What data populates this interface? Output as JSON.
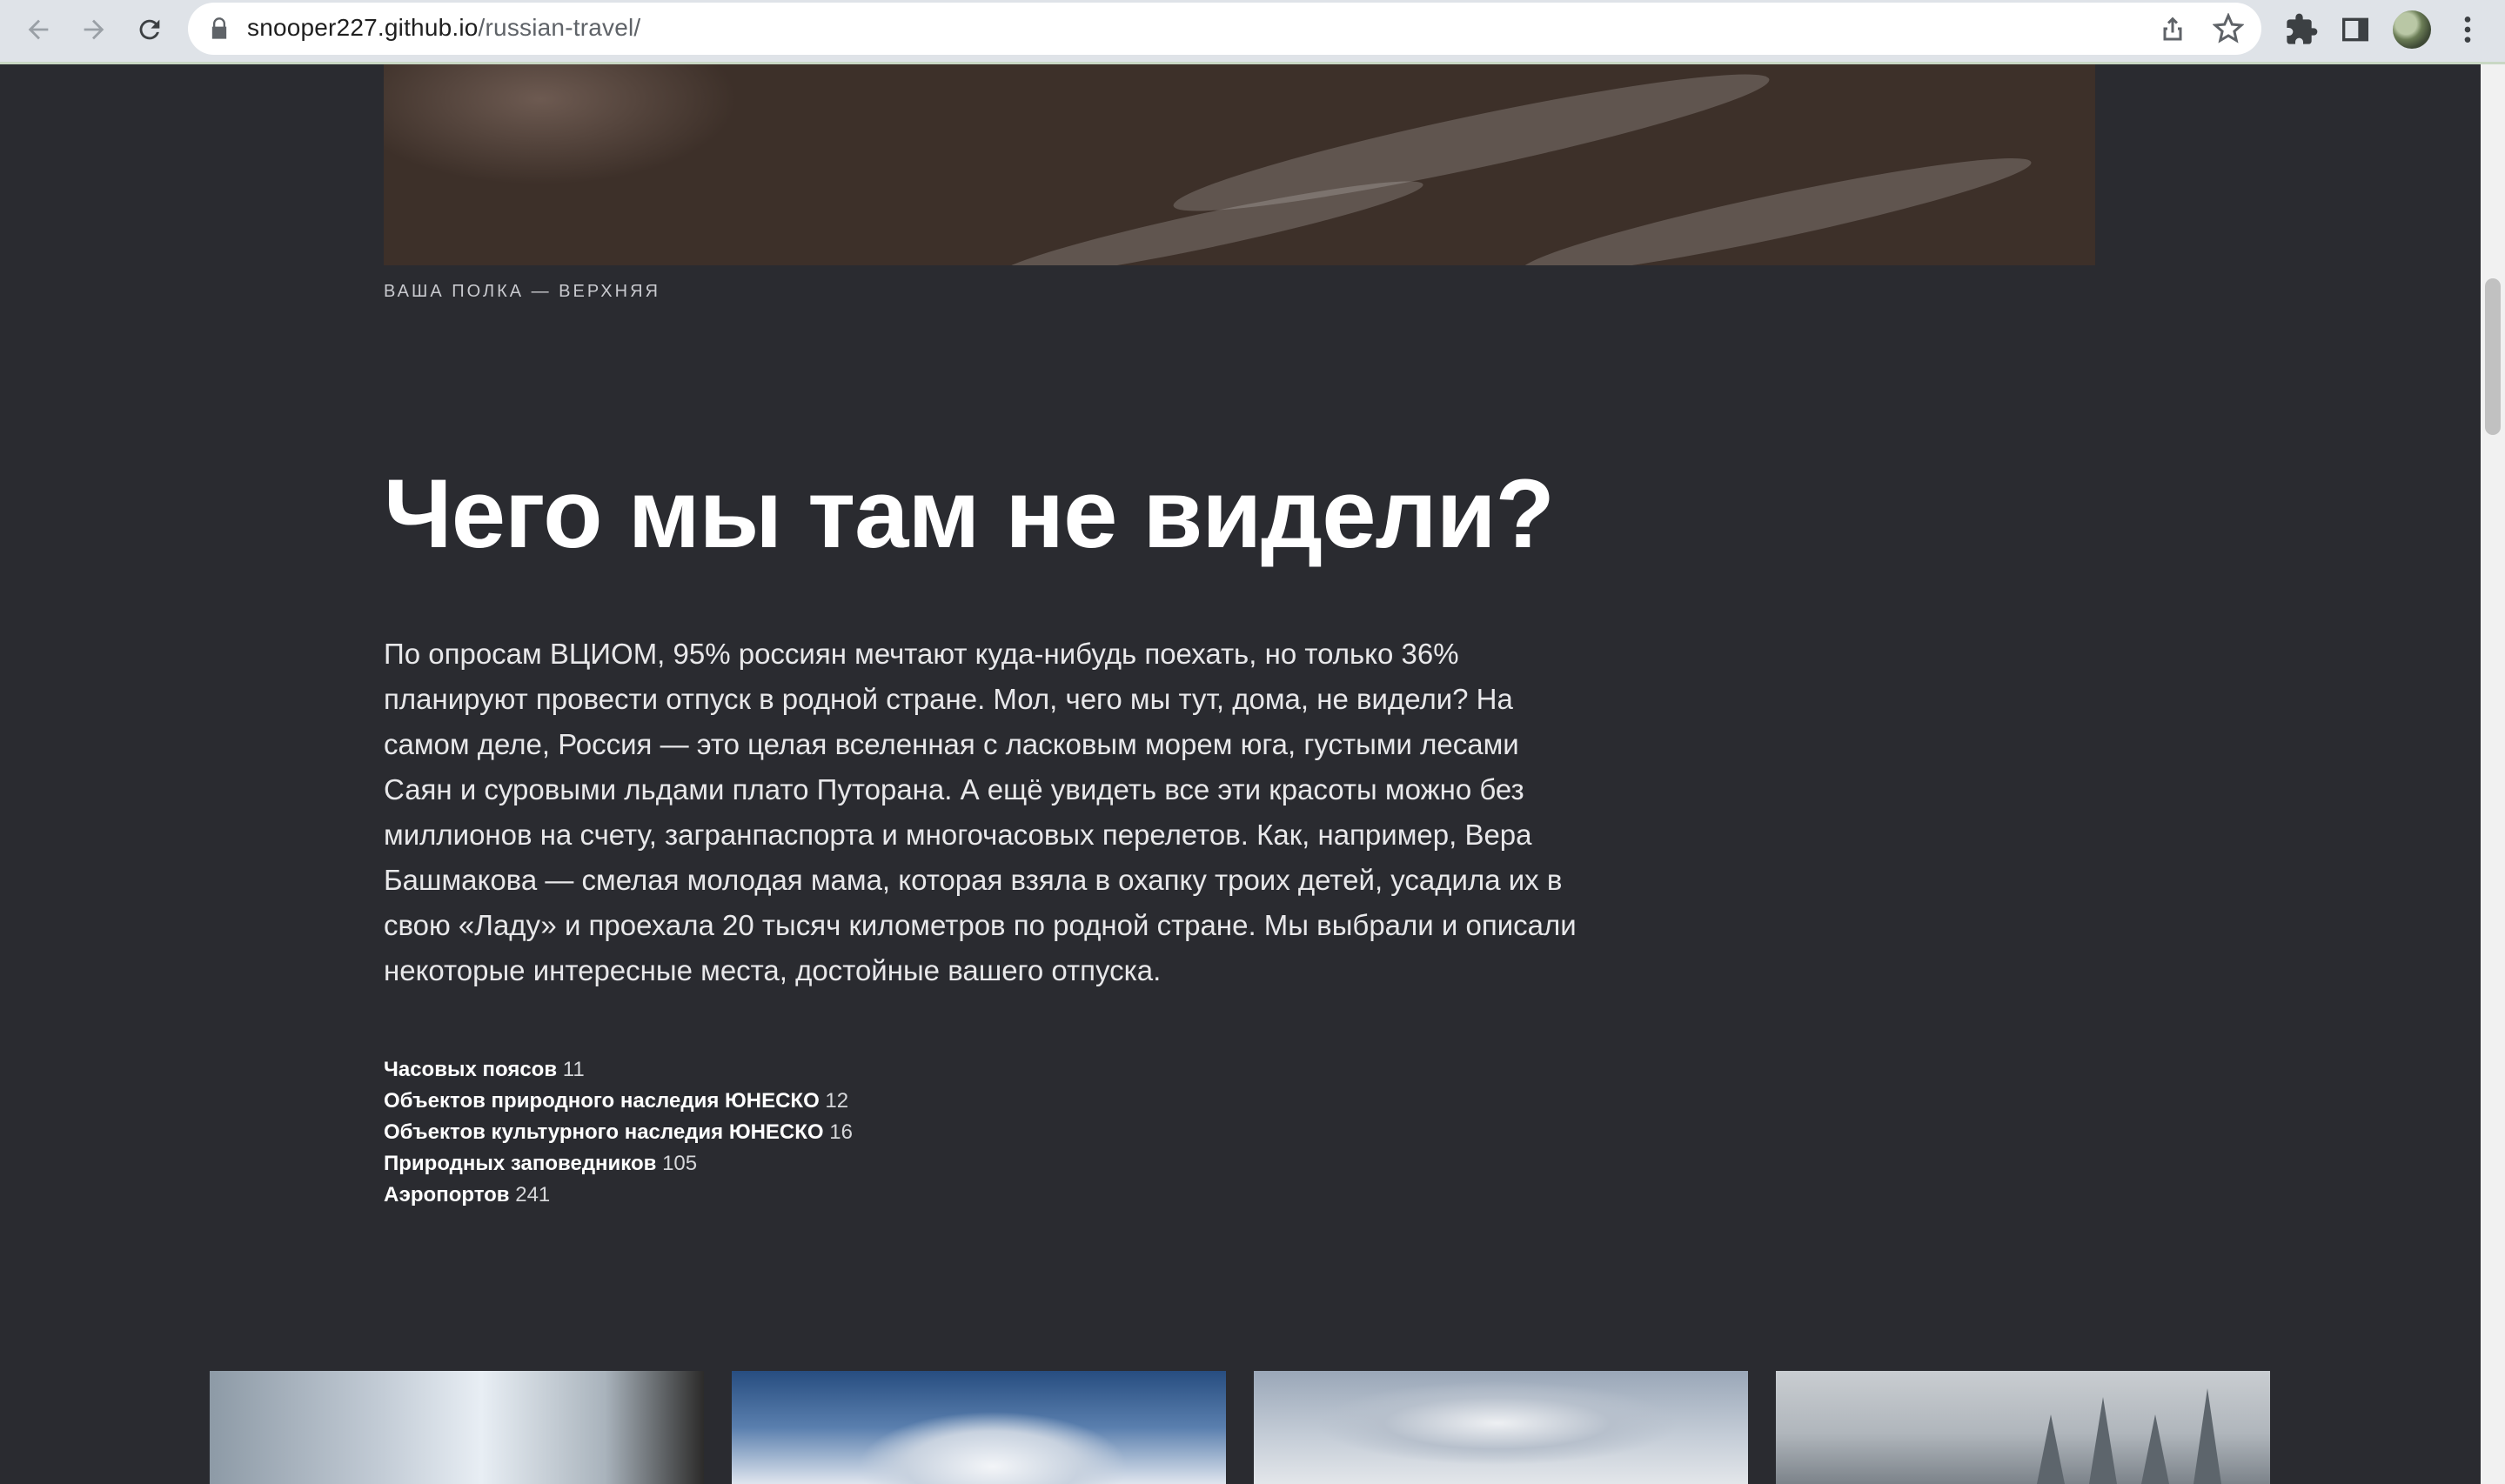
{
  "browser": {
    "url_domain": "snooper227.github.io",
    "url_path": "/russian-travel/",
    "icons": {
      "back": "arrow-left-icon",
      "forward": "arrow-right-icon",
      "reload": "reload-icon",
      "lock": "lock-icon",
      "share": "share-icon",
      "bookmark": "star-icon",
      "extensions": "puzzle-icon",
      "side_panel": "side-panel-icon",
      "menu": "kebab-menu-icon"
    }
  },
  "page": {
    "hero_caption": "Ваша полка — верхняя",
    "headline": "Чего мы там не видели?",
    "lead": "По опросам ВЦИОМ, 95% россиян мечтают куда-нибудь поехать, но только 36% планируют провести отпуск в родной стране. Мол, чего мы тут, дома, не видели? На самом деле, Россия — это целая вселенная с ласковым морем юга, густыми лесами Саян и суровыми льдами плато Путорана. А ещё увидеть все эти красоты можно без миллионов на счету, загранпаспорта и многочасовых перелетов. Как, например, Вера Башмакова — смелая молодая мама, которая взяла в охапку троих детей, усадила их в свою «Ладу» и проехала 20 тысяч километров по родной стране. Мы выбрали и описали некоторые интересные места, достойные вашего отпуска.",
    "stats": [
      {
        "label": "Часовых поясов",
        "value": "11"
      },
      {
        "label": "Объектов природного наследия ЮНЕСКО",
        "value": "12"
      },
      {
        "label": "Объектов культурного наследия ЮНЕСКО",
        "value": "16"
      },
      {
        "label": "Природных заповедников",
        "value": "105"
      },
      {
        "label": "Аэропортов",
        "value": "241"
      }
    ]
  },
  "colors": {
    "background": "#2a2b30",
    "text": "#ffffff",
    "chrome": "#dfe3e8"
  }
}
